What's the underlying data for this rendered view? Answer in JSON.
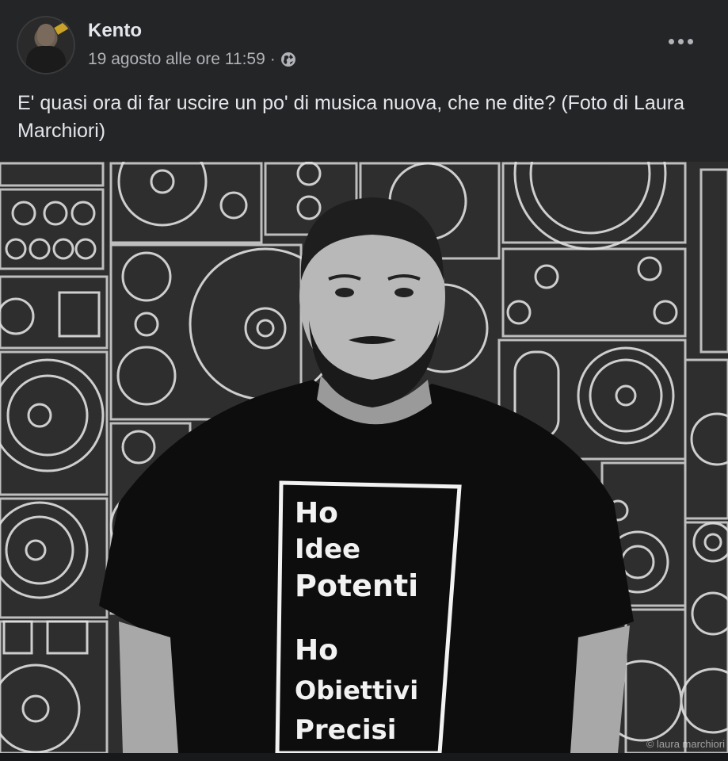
{
  "post": {
    "author": "Kento",
    "timestamp": "19 agosto alle ore 11:59",
    "separator": "·",
    "audience_icon": "globe-icon",
    "more_icon": "more-options-icon",
    "text": "E' quasi ora di far uscire un po' di musica nuova, che ne dite? (Foto di Laura Marchiori)",
    "photo": {
      "credit": "© laura marchiori",
      "shirt_lines": [
        "Ho",
        "Idee",
        "Potenti",
        "Ho",
        "Obiettivi",
        "Precisi"
      ]
    }
  },
  "colors": {
    "background": "#242526",
    "primary_text": "#e4e6eb",
    "secondary_text": "#b0b3b8"
  }
}
